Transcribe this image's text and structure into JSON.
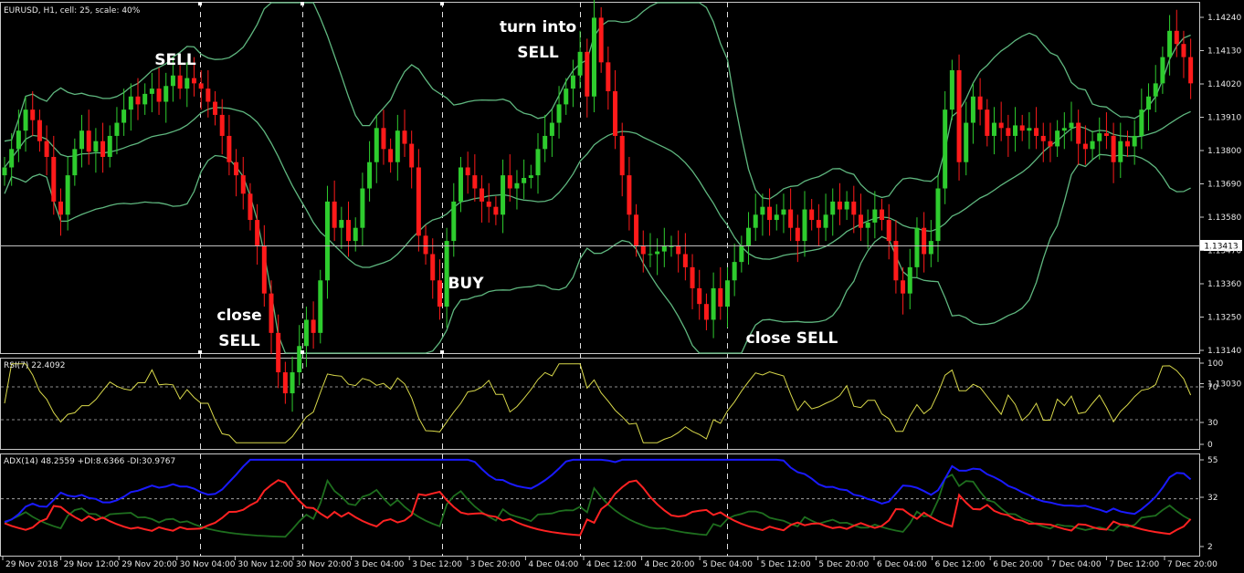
{
  "colors": {
    "background": "#000000",
    "bull": "#2ecc2e",
    "bear": "#ff1a1a",
    "band": "#5fb77f",
    "axis": "#c8c8c8",
    "rsi": "#d8d84a",
    "adx": "#1a1aff",
    "di_plus": "#1e6e1e",
    "di_minus": "#ff2222"
  },
  "main_panel": {
    "header": "EURUSD, H1, cell: 25, scale: 40%",
    "price_labels": [
      "1.14240",
      "1.14130",
      "1.14020",
      "1.13910",
      "1.13800",
      "1.13690",
      "1.13580",
      "1.13470",
      "1.13360",
      "1.13250",
      "1.13140",
      "1.13030"
    ],
    "current_price": "1.13413"
  },
  "rsi_panel": {
    "header": "RSI(7) 22.4092",
    "levels": [
      "100",
      "70",
      "30",
      "0"
    ]
  },
  "adx_panel": {
    "header": "ADX(14) 48.2559 +DI:8.6366 -DI:30.9767",
    "levels": [
      "55",
      "32",
      "2"
    ]
  },
  "time_labels": [
    "29 Nov 2018",
    "29 Nov 12:00",
    "29 Nov 20:00",
    "30 Nov 04:00",
    "30 Nov 12:00",
    "30 Nov 20:00",
    "3 Dec 04:00",
    "3 Dec 12:00",
    "3 Dec 20:00",
    "4 Dec 04:00",
    "4 Dec 12:00",
    "4 Dec 20:00",
    "5 Dec 04:00",
    "5 Dec 12:00",
    "5 Dec 20:00",
    "6 Dec 04:00",
    "6 Dec 12:00",
    "6 Dec 20:00",
    "7 Dec 04:00",
    "7 Dec 12:00",
    "7 Dec 20:00"
  ],
  "annotations": {
    "sell": "SELL",
    "close_sell_1_line1": "close",
    "close_sell_1_line2": "SELL",
    "buy": "BUY",
    "turn_into_line1": "turn into",
    "turn_into_line2": "SELL",
    "close_sell_2": "close SELL"
  },
  "chart_data": {
    "type": "candlestick",
    "symbol": "EURUSD",
    "timeframe": "H1",
    "ylim": [
      1.1298,
      1.143
    ],
    "current_price": 1.13413,
    "close": [
      1.1368,
      1.1375,
      1.1382,
      1.139,
      1.1386,
      1.1378,
      1.1372,
      1.1355,
      1.135,
      1.1365,
      1.1375,
      1.1382,
      1.1374,
      1.1378,
      1.1372,
      1.138,
      1.1385,
      1.139,
      1.1395,
      1.1392,
      1.1396,
      1.1398,
      1.1393,
      1.1399,
      1.1403,
      1.1398,
      1.1402,
      1.14,
      1.1398,
      1.1393,
      1.1388,
      1.138,
      1.137,
      1.1365,
      1.1358,
      1.1348,
      1.1338,
      1.132,
      1.1305,
      1.129,
      1.1282,
      1.129,
      1.13,
      1.131,
      1.1305,
      1.1325,
      1.1355,
      1.1345,
      1.1348,
      1.134,
      1.1345,
      1.136,
      1.137,
      1.1383,
      1.1375,
      1.137,
      1.1382,
      1.1377,
      1.1368,
      1.1342,
      1.1335,
      1.1325,
      1.1315,
      1.134,
      1.1355,
      1.1368,
      1.1365,
      1.136,
      1.1355,
      1.1353,
      1.135,
      1.1365,
      1.136,
      1.1362,
      1.1364,
      1.1365,
      1.1375,
      1.138,
      1.1385,
      1.1392,
      1.1398,
      1.1403,
      1.1412,
      1.1395,
      1.1425,
      1.1408,
      1.1397,
      1.138,
      1.1365,
      1.135,
      1.1338,
      1.1335,
      1.1335,
      1.1336,
      1.1338,
      1.1338,
      1.1335,
      1.133,
      1.1322,
      1.1316,
      1.131,
      1.1322,
      1.1315,
      1.1325,
      1.1332,
      1.1338,
      1.1345,
      1.135,
      1.1353,
      1.1348,
      1.135,
      1.1352,
      1.1345,
      1.134,
      1.1352,
      1.1348,
      1.1345,
      1.135,
      1.1355,
      1.1352,
      1.1355,
      1.135,
      1.1345,
      1.1347,
      1.1352,
      1.1348,
      1.134,
      1.1325,
      1.132,
      1.133,
      1.1345,
      1.1335,
      1.134,
      1.136,
      1.139,
      1.1405,
      1.137,
      1.1385,
      1.1395,
      1.139,
      1.138,
      1.1385,
      1.1383,
      1.138,
      1.1384,
      1.1382,
      1.1383,
      1.138,
      1.1378,
      1.1376,
      1.1382,
      1.1383,
      1.1385,
      1.1377,
      1.1375,
      1.1378,
      1.1381,
      1.138,
      1.137,
      1.1378,
      1.1376,
      1.138,
      1.139,
      1.1395,
      1.14,
      1.141,
      1.142,
      1.1415,
      1.141,
      1.14
    ]
  }
}
